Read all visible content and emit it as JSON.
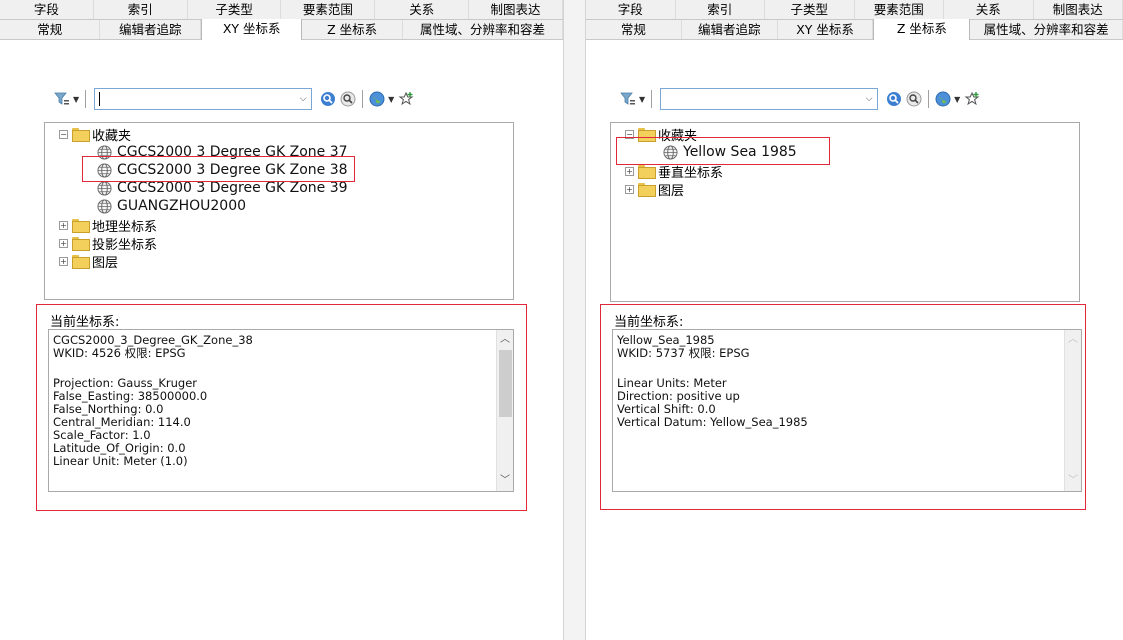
{
  "left": {
    "tabs_row1": [
      "字段",
      "索引",
      "子类型",
      "要素范围",
      "关系",
      "制图表达"
    ],
    "tabs_row2": [
      "常规",
      "编辑者追踪",
      "XY 坐标系",
      "Z 坐标系",
      "属性域、分辨率和容差"
    ],
    "active_tab": "XY 坐标系",
    "search": {
      "value": "",
      "placeholder": ""
    },
    "tree": {
      "favorites_label": "收藏夹",
      "favorites": [
        "CGCS2000 3 Degree GK Zone 37",
        "CGCS2000 3 Degree GK Zone 38",
        "CGCS2000 3 Degree GK Zone 39",
        "GUANGZHOU2000"
      ],
      "folders": [
        "地理坐标系",
        "投影坐标系",
        "图层"
      ]
    },
    "current_label": "当前坐标系:",
    "details": [
      "CGCS2000_3_Degree_GK_Zone_38",
      "WKID: 4526 权限: EPSG",
      "",
      "Projection: Gauss_Kruger",
      "False_Easting: 38500000.0",
      "False_Northing: 0.0",
      "Central_Meridian: 114.0",
      "Scale_Factor: 1.0",
      "Latitude_Of_Origin: 0.0",
      "Linear Unit: Meter (1.0)"
    ]
  },
  "right": {
    "tabs_row1": [
      "字段",
      "索引",
      "子类型",
      "要素范围",
      "关系",
      "制图表达"
    ],
    "tabs_row2": [
      "常规",
      "编辑者追踪",
      "XY 坐标系",
      "Z 坐标系",
      "属性域、分辨率和容差"
    ],
    "active_tab": "Z 坐标系",
    "search": {
      "value": "",
      "placeholder": ""
    },
    "tree": {
      "favorites_label": "收藏夹",
      "favorites": [
        "Yellow Sea 1985"
      ],
      "folders": [
        "垂直坐标系",
        "图层"
      ]
    },
    "current_label": "当前坐标系:",
    "details": [
      "Yellow_Sea_1985",
      "WKID: 5737 权限: EPSG",
      "",
      "Linear Units: Meter",
      "Direction: positive up",
      "Vertical Shift: 0.0",
      "Vertical Datum: Yellow_Sea_1985"
    ]
  },
  "icons": {
    "filter": "filter-icon",
    "search": "search-icon",
    "clear_search": "clear-search-icon",
    "globe": "globe-icon",
    "add_favorite": "add-favorite-icon"
  },
  "colors": {
    "highlight_red": "#e0283a",
    "tab_bg": "#f0f0f0",
    "folder": "#f3cf5b"
  }
}
